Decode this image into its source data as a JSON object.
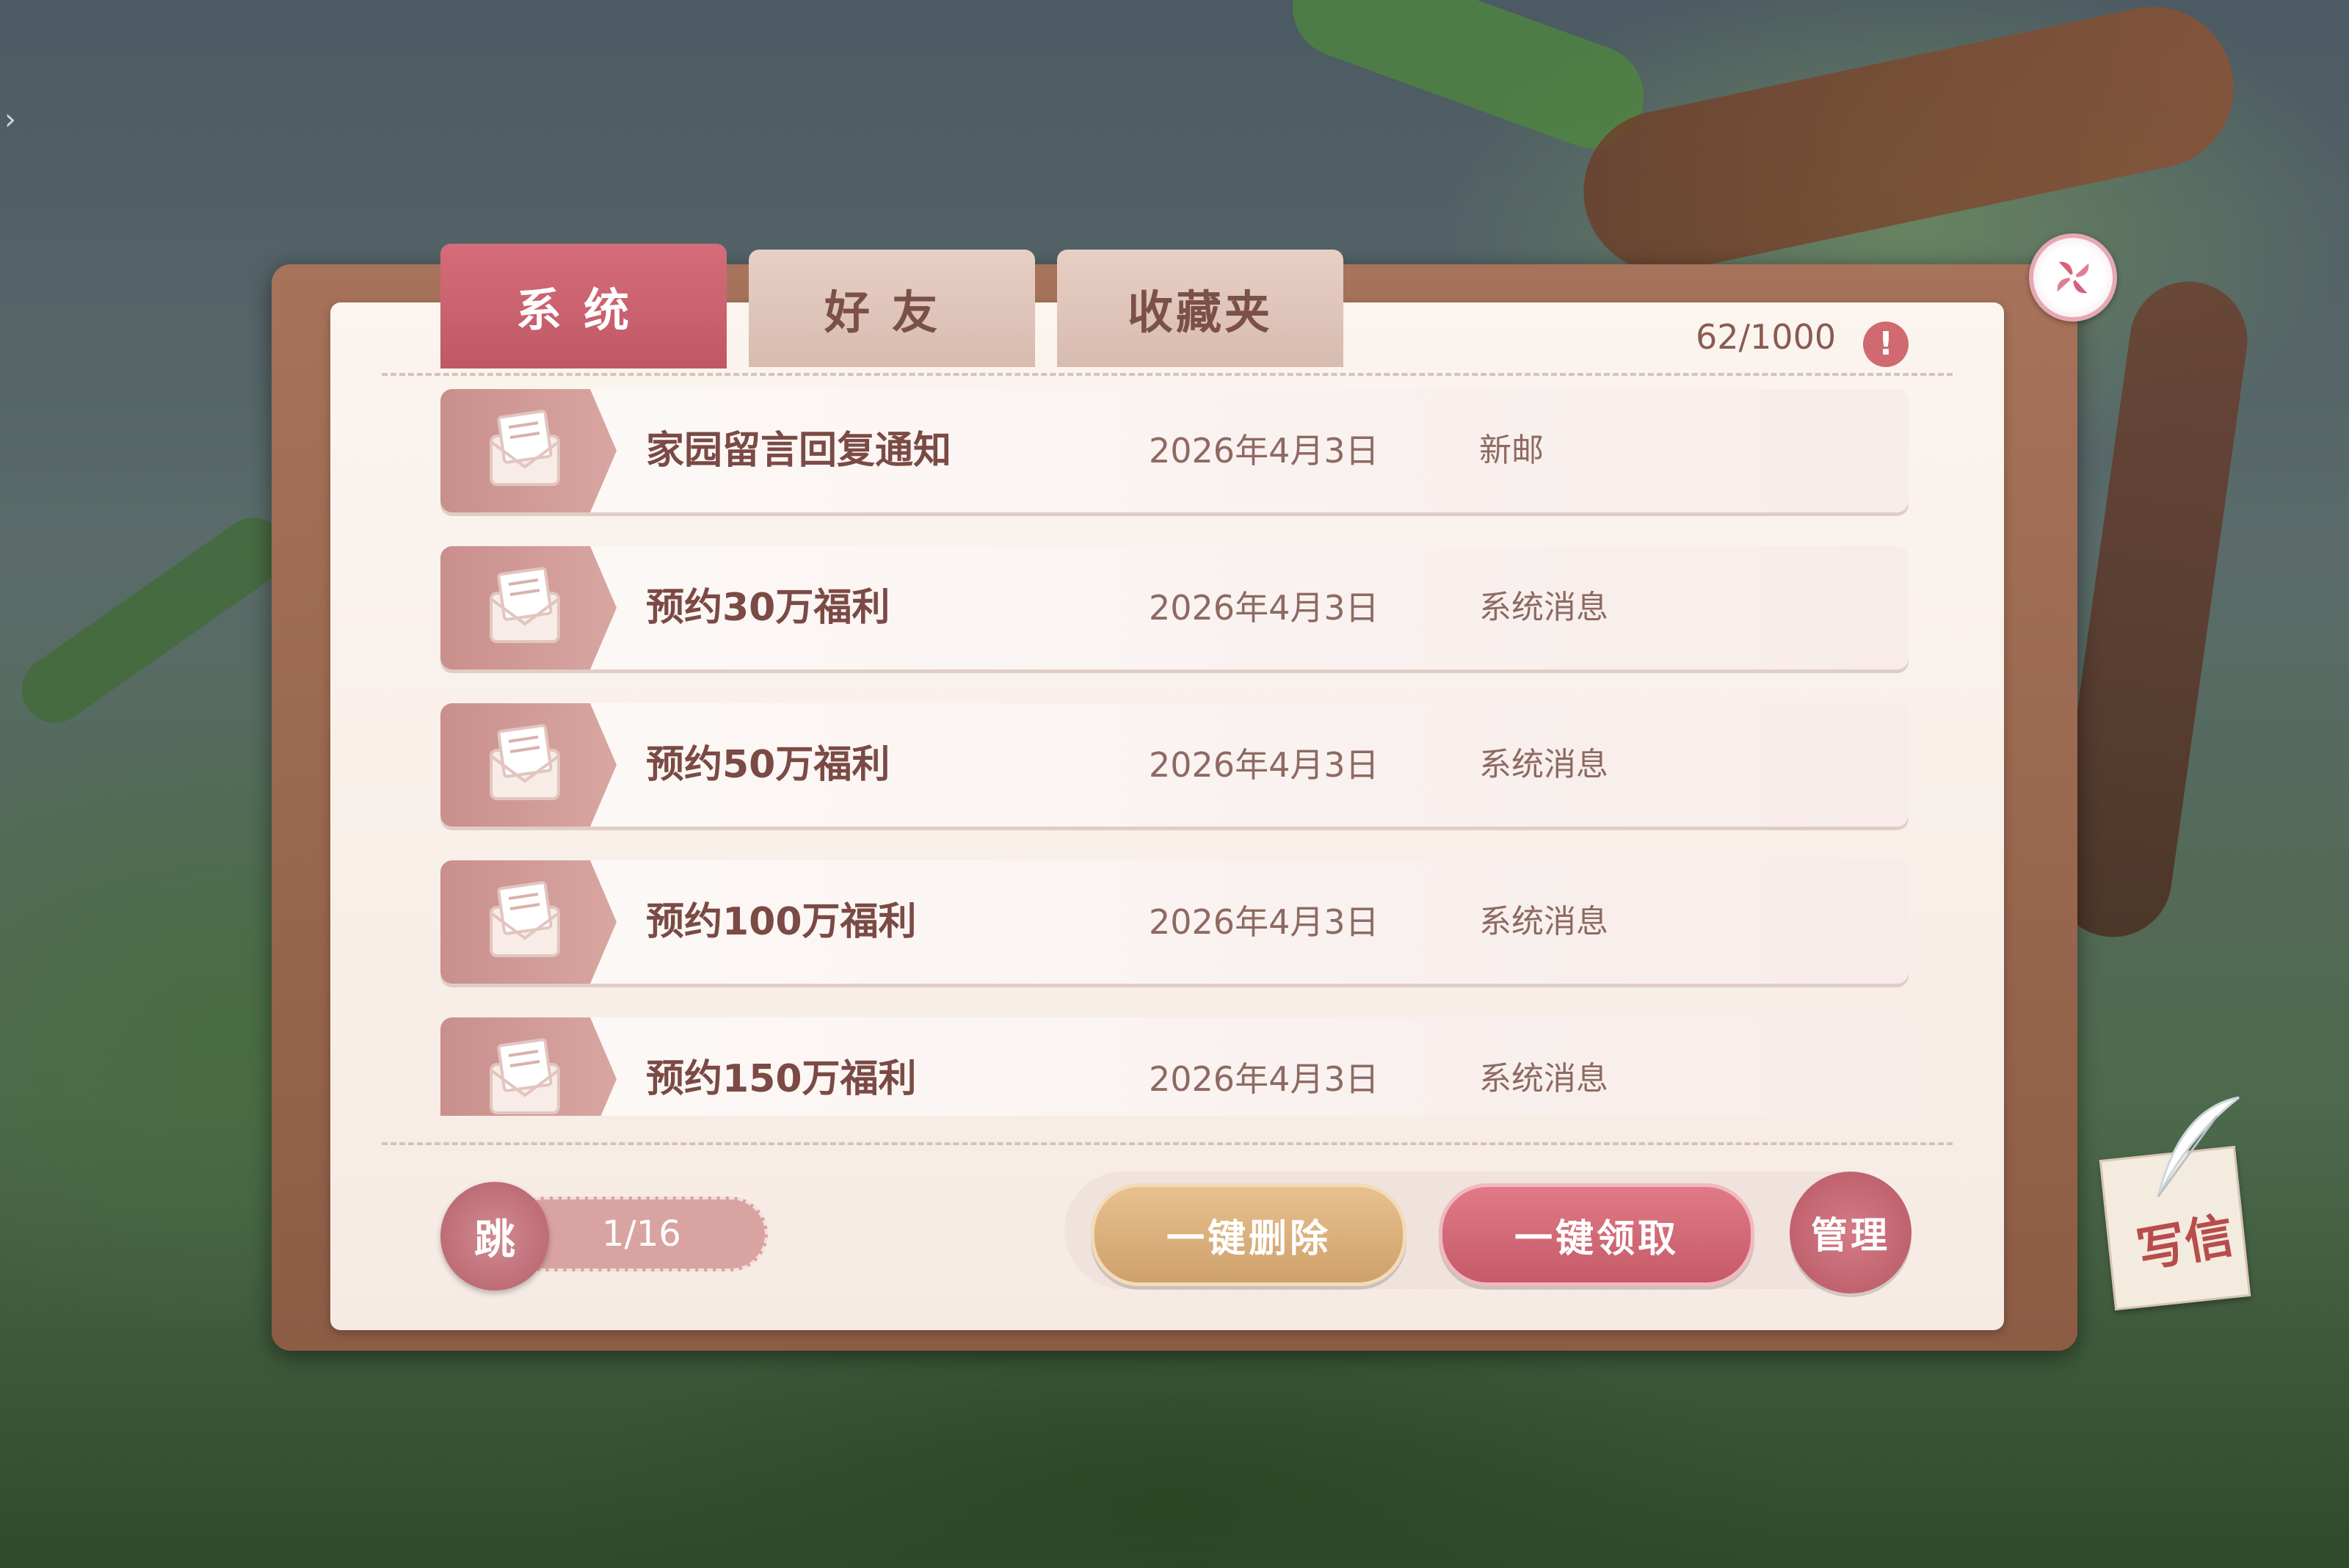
{
  "tabs": [
    {
      "label": "系统",
      "active": true
    },
    {
      "label": "好友",
      "active": false
    },
    {
      "label": "收藏夹",
      "active": false
    }
  ],
  "mail_count": "62/1000",
  "warning_symbol": "!",
  "mails": [
    {
      "title": "家园留言回复通知",
      "date": "2026年4月3日",
      "type": "新邮"
    },
    {
      "title": "预约30万福利",
      "date": "2026年4月3日",
      "type": "系统消息"
    },
    {
      "title": "预约50万福利",
      "date": "2026年4月3日",
      "type": "系统消息"
    },
    {
      "title": "预约100万福利",
      "date": "2026年4月3日",
      "type": "系统消息"
    },
    {
      "title": "预约150万福利",
      "date": "2026年4月3日",
      "type": "系统消息"
    }
  ],
  "pagination": {
    "jump_label": "跳",
    "page": "1/16"
  },
  "buttons": {
    "delete_all": "一键删除",
    "claim_all": "一键领取",
    "manage": "管理"
  },
  "write_letter": "写信",
  "icons": {
    "close": "pinwheel-close-icon",
    "mail": "envelope-letter-icon",
    "write": "quill-letter-icon"
  },
  "colors": {
    "accent": "#c65a68",
    "gold": "#cfa06a",
    "text": "#7b4a44"
  }
}
